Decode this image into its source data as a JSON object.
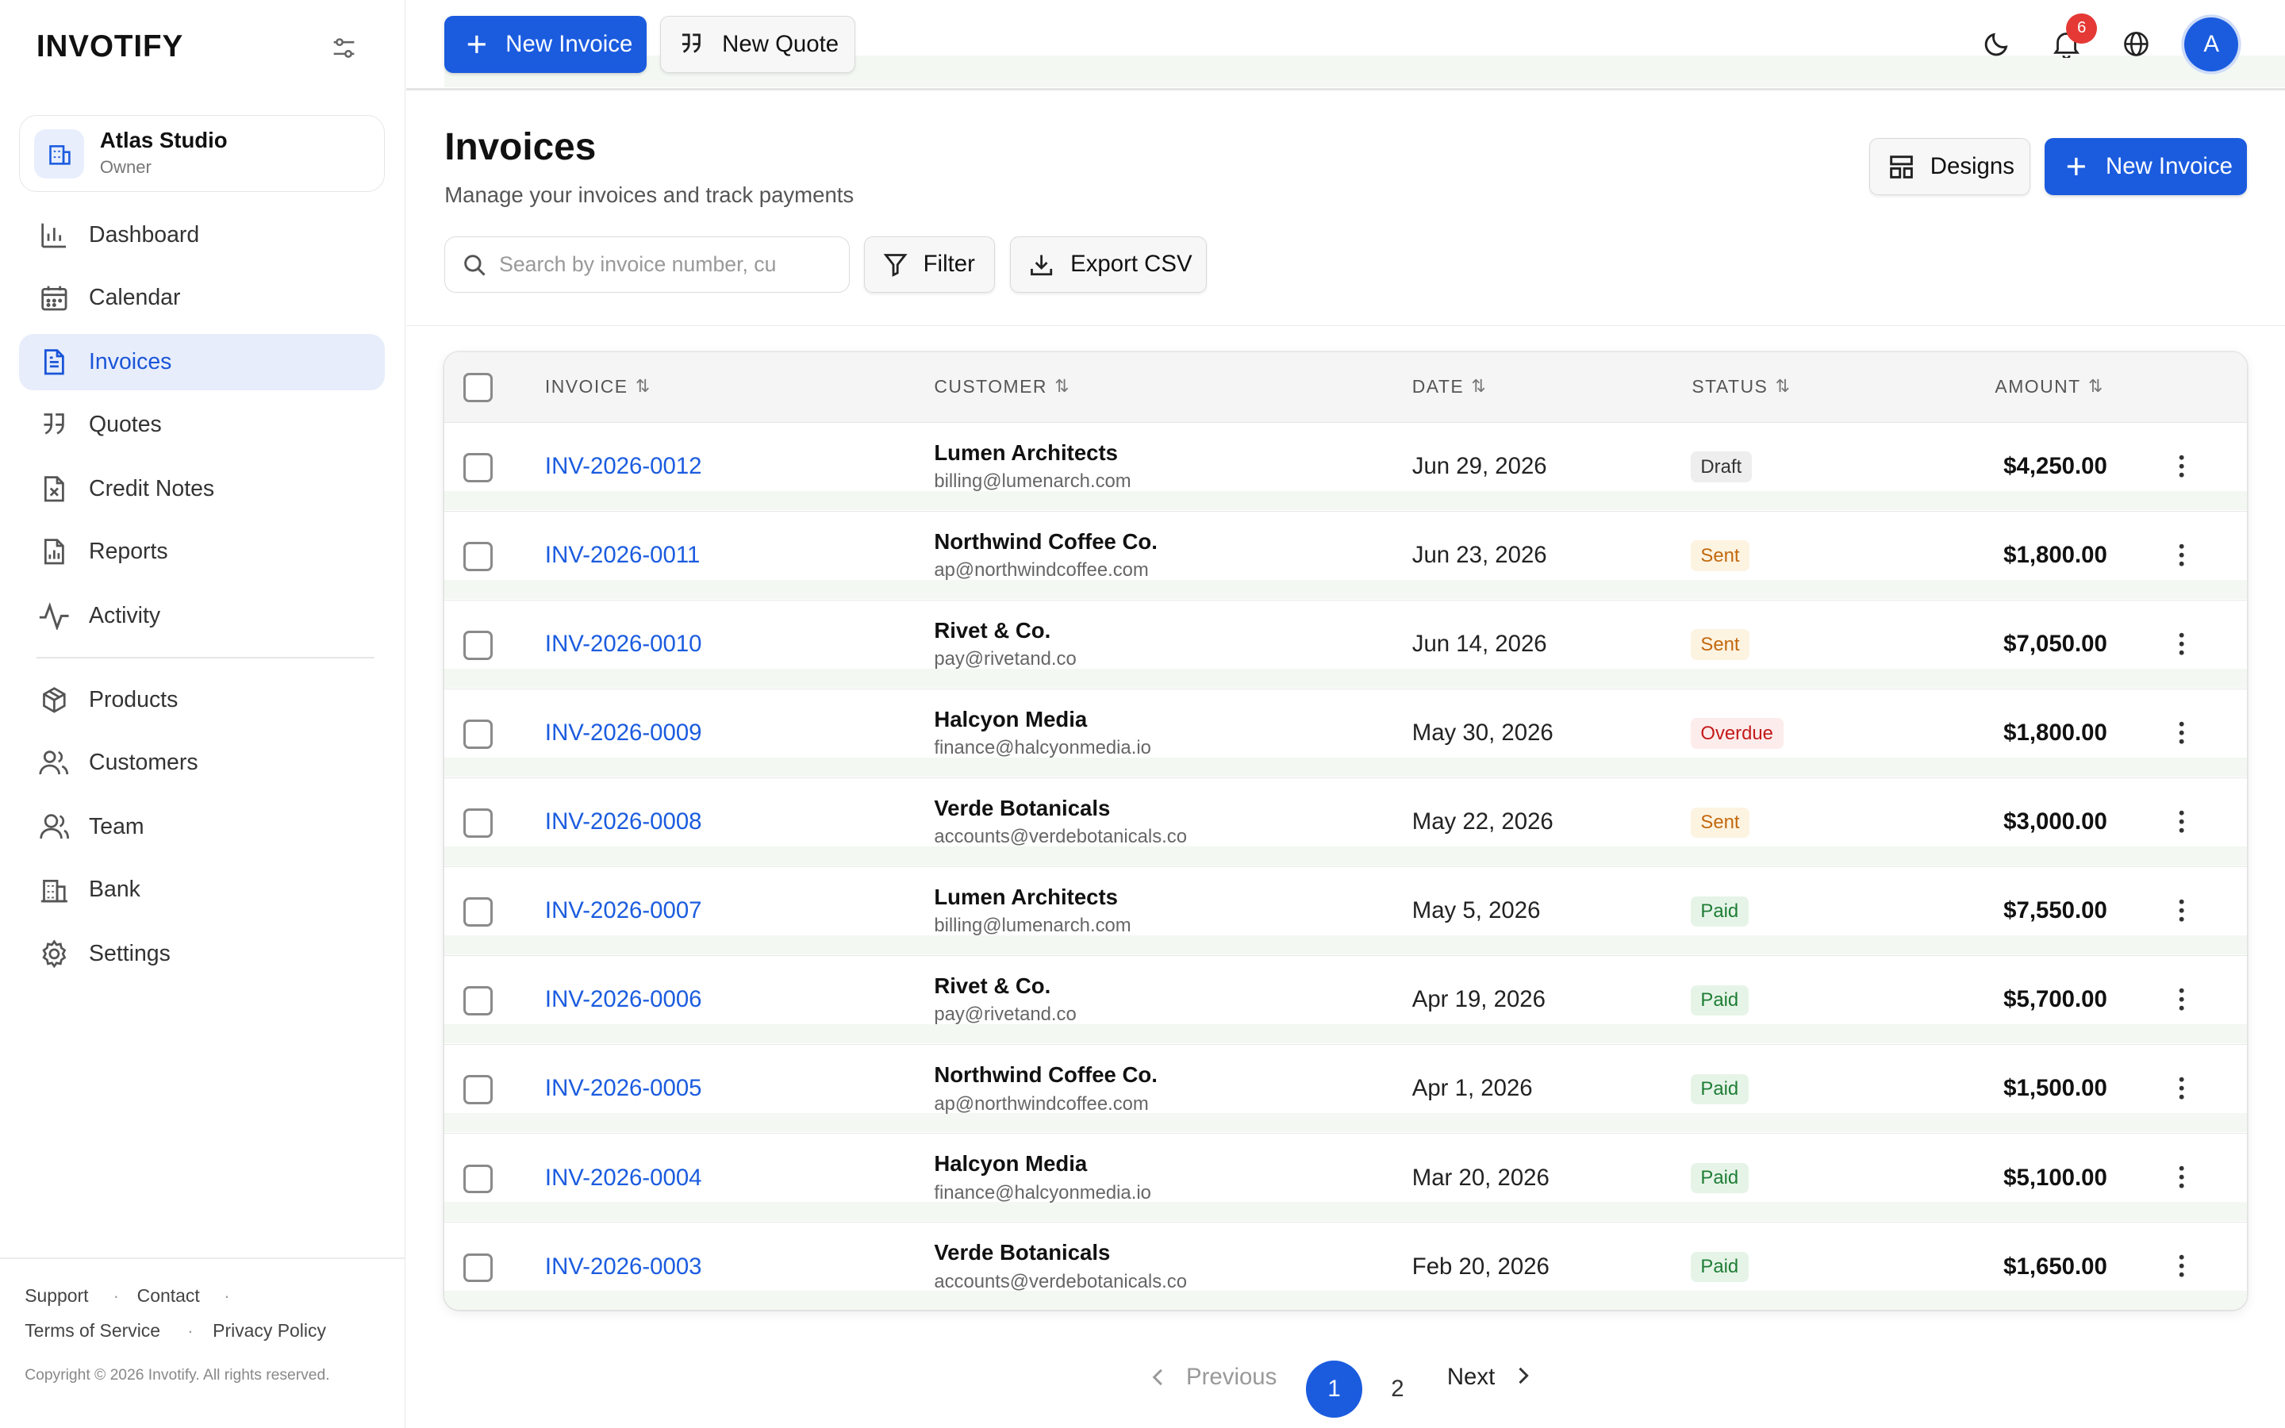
{
  "app": {
    "logo": "INVOTIFY"
  },
  "org": {
    "name": "Atlas Studio",
    "role": "Owner"
  },
  "nav": {
    "items": [
      {
        "label": "Dashboard",
        "icon": "bar-chart-icon"
      },
      {
        "label": "Calendar",
        "icon": "calendar-icon"
      },
      {
        "label": "Invoices",
        "icon": "document-icon",
        "active": true
      },
      {
        "label": "Quotes",
        "icon": "quote-icon"
      },
      {
        "label": "Credit Notes",
        "icon": "credit-note-icon"
      },
      {
        "label": "Reports",
        "icon": "report-icon"
      },
      {
        "label": "Activity",
        "icon": "activity-icon"
      },
      {
        "label": "Products",
        "icon": "package-icon"
      },
      {
        "label": "Customers",
        "icon": "users-icon"
      },
      {
        "label": "Team",
        "icon": "team-icon"
      },
      {
        "label": "Bank",
        "icon": "bank-icon"
      },
      {
        "label": "Settings",
        "icon": "gear-icon"
      }
    ]
  },
  "footer": {
    "support": "Support",
    "contact": "Contact",
    "terms": "Terms of Service",
    "privacy": "Privacy Policy",
    "copyright": "Copyright © 2026 Invotify. All rights reserved."
  },
  "topbar": {
    "new_invoice": "New Invoice",
    "new_quote": "New Quote",
    "notification_count": "6",
    "avatar_initial": "A"
  },
  "page": {
    "title": "Invoices",
    "subtitle": "Manage your invoices and track payments",
    "designs": "Designs",
    "new_invoice": "New Invoice",
    "search_placeholder": "Search by invoice number, cu",
    "filter": "Filter",
    "export": "Export CSV"
  },
  "table": {
    "headers": {
      "invoice": "INVOICE",
      "customer": "CUSTOMER",
      "date": "DATE",
      "status": "STATUS",
      "amount": "AMOUNT"
    },
    "rows": [
      {
        "invoice": "INV-2026-0012",
        "customer": "Lumen Architects",
        "email": "billing@lumenarch.com",
        "date": "Jun 29, 2026",
        "status": "Draft",
        "amount": "$4,250.00"
      },
      {
        "invoice": "INV-2026-0011",
        "customer": "Northwind Coffee Co.",
        "email": "ap@northwindcoffee.com",
        "date": "Jun 23, 2026",
        "status": "Sent",
        "amount": "$1,800.00"
      },
      {
        "invoice": "INV-2026-0010",
        "customer": "Rivet & Co.",
        "email": "pay@rivetand.co",
        "date": "Jun 14, 2026",
        "status": "Sent",
        "amount": "$7,050.00"
      },
      {
        "invoice": "INV-2026-0009",
        "customer": "Halcyon Media",
        "email": "finance@halcyonmedia.io",
        "date": "May 30, 2026",
        "status": "Overdue",
        "amount": "$1,800.00"
      },
      {
        "invoice": "INV-2026-0008",
        "customer": "Verde Botanicals",
        "email": "accounts@verdebotanicals.co",
        "date": "May 22, 2026",
        "status": "Sent",
        "amount": "$3,000.00"
      },
      {
        "invoice": "INV-2026-0007",
        "customer": "Lumen Architects",
        "email": "billing@lumenarch.com",
        "date": "May 5, 2026",
        "status": "Paid",
        "amount": "$7,550.00"
      },
      {
        "invoice": "INV-2026-0006",
        "customer": "Rivet & Co.",
        "email": "pay@rivetand.co",
        "date": "Apr 19, 2026",
        "status": "Paid",
        "amount": "$5,700.00"
      },
      {
        "invoice": "INV-2026-0005",
        "customer": "Northwind Coffee Co.",
        "email": "ap@northwindcoffee.com",
        "date": "Apr 1, 2026",
        "status": "Paid",
        "amount": "$1,500.00"
      },
      {
        "invoice": "INV-2026-0004",
        "customer": "Halcyon Media",
        "email": "finance@halcyonmedia.io",
        "date": "Mar 20, 2026",
        "status": "Paid",
        "amount": "$5,100.00"
      },
      {
        "invoice": "INV-2026-0003",
        "customer": "Verde Botanicals",
        "email": "accounts@verdebotanicals.co",
        "date": "Feb 20, 2026",
        "status": "Paid",
        "amount": "$1,650.00"
      }
    ]
  },
  "pagination": {
    "previous": "Previous",
    "pages": [
      "1",
      "2"
    ],
    "current": "1",
    "next": "Next"
  },
  "colors": {
    "accent": "#1b5cdf",
    "active_nav_bg": "#e7edfb",
    "draft": "#333333",
    "sent": "#c2690e",
    "overdue": "#c41a1a",
    "paid": "#1e7d34",
    "badge": "#e53935"
  }
}
